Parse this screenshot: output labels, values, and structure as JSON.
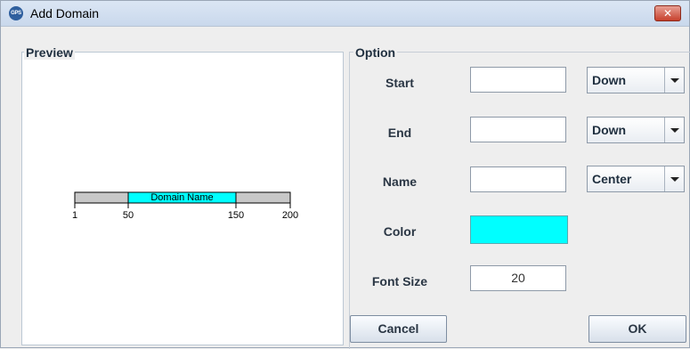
{
  "window": {
    "title": "Add Domain",
    "icon_text": "GPS",
    "close_glyph": "✕"
  },
  "preview": {
    "label": "Preview",
    "domain_label": "Domain Name",
    "domain_color": "#00ffff",
    "ticks": [
      "1",
      "50",
      "150",
      "200"
    ]
  },
  "option": {
    "label": "Option",
    "start": {
      "label": "Start",
      "value": "",
      "position": "Down"
    },
    "end": {
      "label": "End",
      "value": "",
      "position": "Down"
    },
    "name": {
      "label": "Name",
      "value": "",
      "position": "Center"
    },
    "color": {
      "label": "Color",
      "value": "#00ffff"
    },
    "font_size": {
      "label": "Font Size",
      "value": "20"
    }
  },
  "buttons": {
    "cancel": "Cancel",
    "ok": "OK"
  }
}
